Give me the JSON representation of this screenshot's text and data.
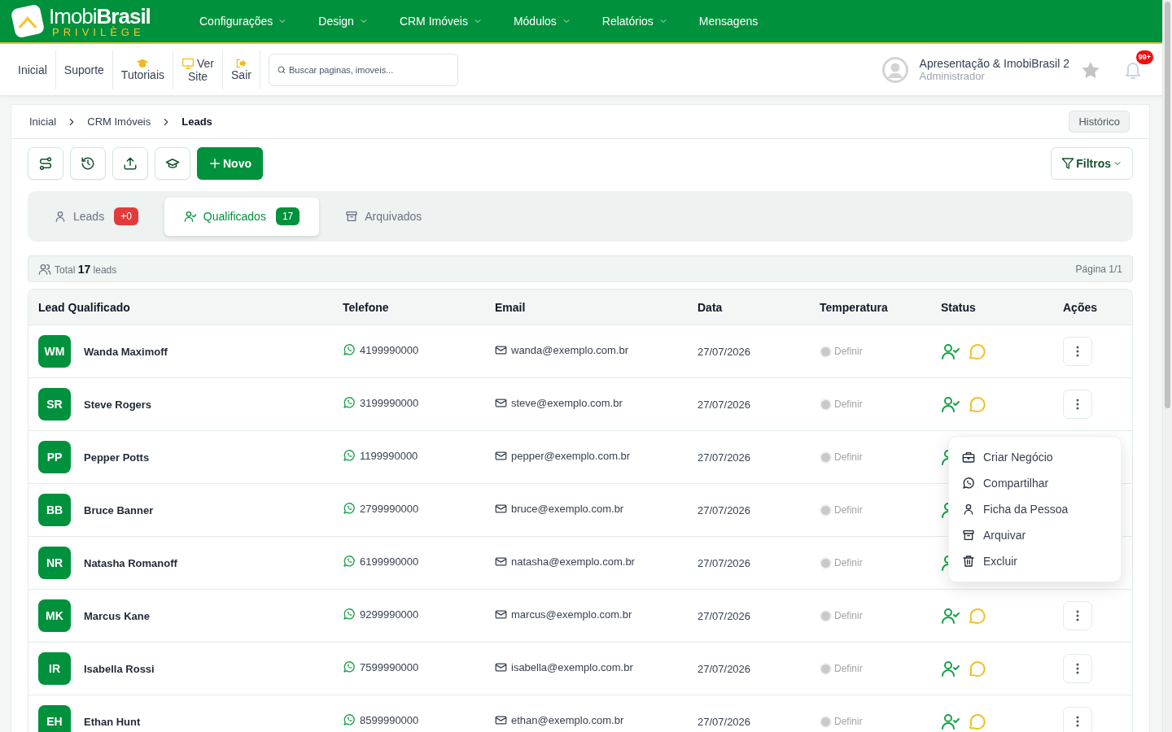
{
  "brand": {
    "name_light": "Imobi",
    "name_bold": "Brasil",
    "tagline": "PRIVILÈGE"
  },
  "main_menu": [
    {
      "label": "Configurações",
      "dropdown": true
    },
    {
      "label": "Design",
      "dropdown": true
    },
    {
      "label": "CRM Imóveis",
      "dropdown": true
    },
    {
      "label": "Módulos",
      "dropdown": true
    },
    {
      "label": "Relatórios",
      "dropdown": true
    },
    {
      "label": "Mensagens",
      "dropdown": false
    }
  ],
  "quick_links": [
    {
      "label": "Inicial"
    },
    {
      "label": "Suporte"
    },
    {
      "label": "Tutoriais"
    },
    {
      "label": "Ver Site"
    },
    {
      "label": "Sair"
    }
  ],
  "search": {
    "placeholder": "Buscar paginas, imoveis..."
  },
  "user": {
    "name": "Apresentação & ImobiBrasil 2",
    "role": "Administrador",
    "notifications": "99+"
  },
  "breadcrumb": [
    {
      "label": "Inicial",
      "current": false
    },
    {
      "label": "CRM Imóveis",
      "current": false
    },
    {
      "label": "Leads",
      "current": true
    }
  ],
  "history_button": "Histórico",
  "toolbar": {
    "new_button": "Novo",
    "filters_button": "Filtros"
  },
  "tabs": [
    {
      "label": "Leads",
      "badge": "+0",
      "selected": false
    },
    {
      "label": "Qualificados",
      "badge": "17",
      "selected": true
    },
    {
      "label": "Arquivados",
      "selected": false
    }
  ],
  "summary": {
    "prefix": "Total",
    "count": "17",
    "suffix": "leads",
    "page": "Página 1/1"
  },
  "table": {
    "columns": [
      "Lead Qualificado",
      "Telefone",
      "Email",
      "Data",
      "Temperatura",
      "Status",
      "Ações"
    ],
    "rows": [
      {
        "initials": "WM",
        "name": "Wanda Maximoff",
        "phone": "4199990000",
        "email": "wanda@exemplo.com.br",
        "date": "27/07/2026",
        "temperature": "Definir"
      },
      {
        "initials": "SR",
        "name": "Steve Rogers",
        "phone": "3199990000",
        "email": "steve@exemplo.com.br",
        "date": "27/07/2026",
        "temperature": "Definir",
        "actions_menu": [
          "Criar Negócio",
          "Compartilhar",
          "Ficha da Pessoa",
          "Arquivar",
          "Excluir"
        ]
      },
      {
        "initials": "PP",
        "name": "Pepper Potts",
        "phone": "1199990000",
        "email": "pepper@exemplo.com.br",
        "date": "27/07/2026",
        "temperature": "Definir"
      },
      {
        "initials": "BB",
        "name": "Bruce Banner",
        "phone": "2799990000",
        "email": "bruce@exemplo.com.br",
        "date": "27/07/2026",
        "temperature": "Definir"
      },
      {
        "initials": "NR",
        "name": "Natasha Romanoff",
        "phone": "6199990000",
        "email": "natasha@exemplo.com.br",
        "date": "27/07/2026",
        "temperature": "Definir"
      },
      {
        "initials": "MK",
        "name": "Marcus Kane",
        "phone": "9299990000",
        "email": "marcus@exemplo.com.br",
        "date": "27/07/2026",
        "temperature": "Definir"
      },
      {
        "initials": "IR",
        "name": "Isabella Rossi",
        "phone": "7599990000",
        "email": "isabella@exemplo.com.br",
        "date": "27/07/2026",
        "temperature": "Definir"
      },
      {
        "initials": "EH",
        "name": "Ethan Hunt",
        "phone": "8599990000",
        "email": "ethan@exemplo.com.br",
        "date": "27/07/2026",
        "temperature": "Definir"
      }
    ]
  }
}
